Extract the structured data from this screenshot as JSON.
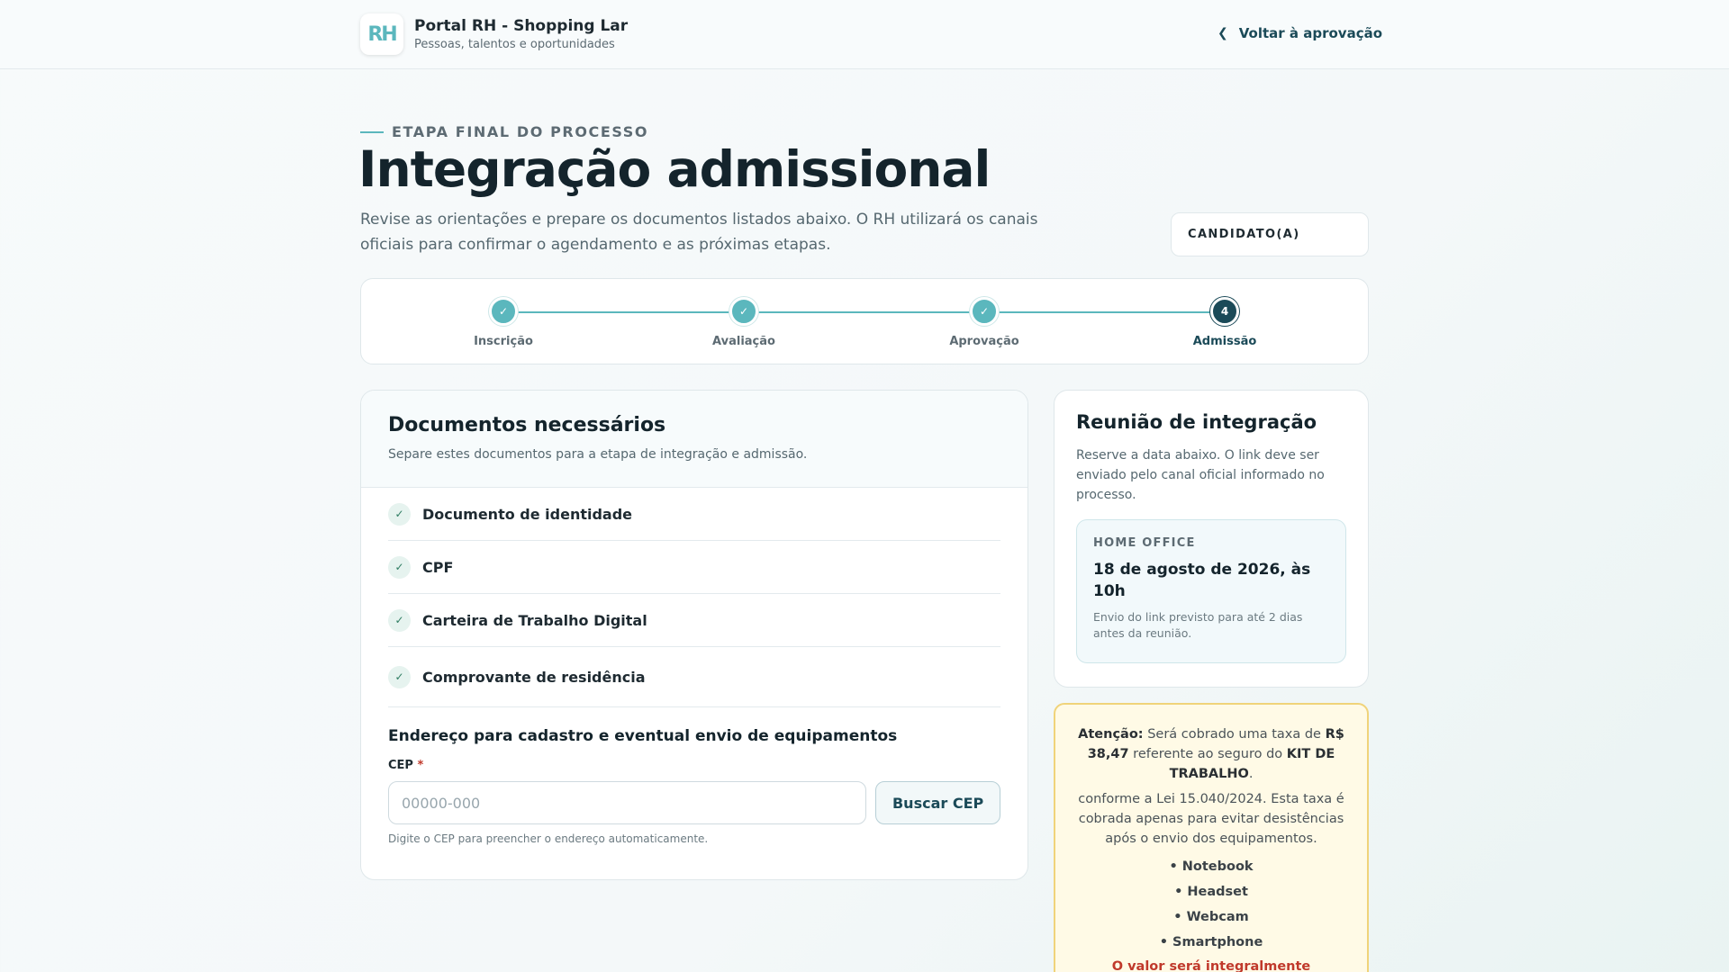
{
  "header": {
    "logo_text": "RH",
    "brand_name": "Portal RH - Shopping Lar",
    "brand_sub": "Pessoas, talentos e oportunidades",
    "back_label": "Voltar à aprovação"
  },
  "hero": {
    "eyebrow": "ETAPA FINAL DO PROCESSO",
    "title": "Integração admissional",
    "intro": "Revise as orientações e prepare os documentos listados abaixo. O RH utilizará os canais oficiais para confirmar o agendamento e as próximas etapas.",
    "candidate_label": "CANDIDATO(A)"
  },
  "stepper": {
    "steps": [
      {
        "label": "Inscrição",
        "mark": "✓"
      },
      {
        "label": "Avaliação",
        "mark": "✓"
      },
      {
        "label": "Aprovação",
        "mark": "✓"
      },
      {
        "label": "Admissão",
        "mark": "4"
      }
    ]
  },
  "documents": {
    "title": "Documentos necessários",
    "subtitle": "Separe estes documentos para a etapa de integração e admissão.",
    "check_mark": "✓",
    "items": [
      "Documento de identidade",
      "CPF",
      "Carteira de Trabalho Digital",
      "Comprovante de residência"
    ],
    "address_title": "Endereço para cadastro e eventual envio de equipamentos",
    "cep_label": "CEP",
    "cep_required": "*",
    "cep_placeholder": "00000-000",
    "cep_button": "Buscar CEP",
    "cep_help": "Digite o CEP para preencher o endereço automaticamente."
  },
  "meeting": {
    "title": "Reunião de integração",
    "desc": "Reserve a data abaixo. O link deve ser enviado pelo canal oficial informado no processo.",
    "tag": "HOME OFFICE",
    "date": "18 de agosto de 2026, às 10h",
    "note": "Envio do link previsto para até 2 dias antes da reunião."
  },
  "warning": {
    "att_label": "Atenção:",
    "text1": " Será cobrado uma taxa de ",
    "amount": "R$ 38,47",
    "text2": " referente ao seguro do ",
    "kit": "KIT DE TRABALHO",
    "text3": ".",
    "law_text": "conforme a Lei 15.040/2024. Esta taxa é cobrada apenas para evitar desistências após o envio dos equipamentos.",
    "items": [
      "• Notebook",
      "• Headset",
      "• Webcam",
      "• Smartphone"
    ],
    "refund": "O valor será integralmente ressarcido"
  }
}
